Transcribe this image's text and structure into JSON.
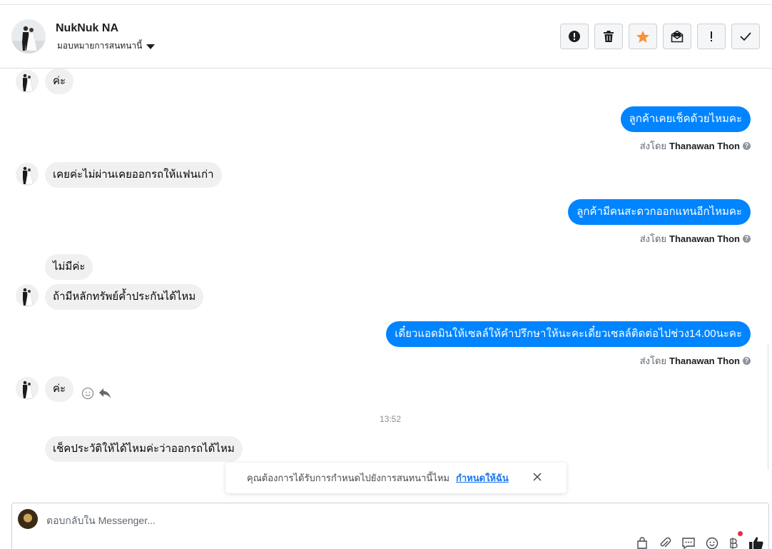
{
  "header": {
    "contact_name": "NukNuk NA",
    "assign_label": "มอบหมายการสนทนานี้"
  },
  "toolbar": [
    {
      "name": "spam-button",
      "icon": "exclamation-circle-icon"
    },
    {
      "name": "delete-button",
      "icon": "trash-icon"
    },
    {
      "name": "star-button",
      "icon": "star-icon",
      "color": "#f7923b"
    },
    {
      "name": "mark-unread-button",
      "icon": "envelope-open-icon"
    },
    {
      "name": "follow-up-button",
      "icon": "exclamation-icon"
    },
    {
      "name": "mark-done-button",
      "icon": "checkmark-icon"
    }
  ],
  "thread": {
    "messages": [
      {
        "dir": "in",
        "text": "ค่ะ"
      },
      {
        "dir": "out",
        "text": "ลูกค้าเคยเช็คด้วยไหมคะ",
        "sent_by_prefix": "ส่งโดย",
        "sent_by": "Thanawan Thon"
      },
      {
        "dir": "in",
        "text": "เคยค่ะไม่ผ่านเคยออกรถให้แฟนเก่า"
      },
      {
        "dir": "out",
        "text": "ลูกค้ามีคนสะดวกออกแทนอีกไหมคะ",
        "sent_by_prefix": "ส่งโดย",
        "sent_by": "Thanawan Thon"
      },
      {
        "dir": "in",
        "text": "ไม่มีค่ะ"
      },
      {
        "dir": "in",
        "text": "ถ้ามีหลักทรัพย์ค้ำประกันได้ไหม"
      },
      {
        "dir": "out",
        "text": "เดี๋ยวแอดมินให้เซลล์ให้คำปรึกษาให้นะคะเดี๋ยวเซลล์ติดต่อไปช่วง14.00นะคะ",
        "sent_by_prefix": "ส่งโดย",
        "sent_by": "Thanawan Thon"
      },
      {
        "dir": "in",
        "text": "ค่ะ"
      },
      {
        "dir": "in",
        "text": "เช็คประวัติให้ได้ไหมค่ะว่าออกรถได้ไหม"
      }
    ],
    "timestamp": "13:52"
  },
  "toast": {
    "text": "คุณต้องการได้รับการกำหนดไปยังการสนทนานี้ไหม",
    "link": "กำหนดให้ฉัน"
  },
  "composer": {
    "placeholder": "ตอบกลับใน Messenger..."
  },
  "colors": {
    "outgoing_bubble": "#0084ff",
    "incoming_bubble": "#f0f0f0",
    "link": "#1877f2"
  }
}
